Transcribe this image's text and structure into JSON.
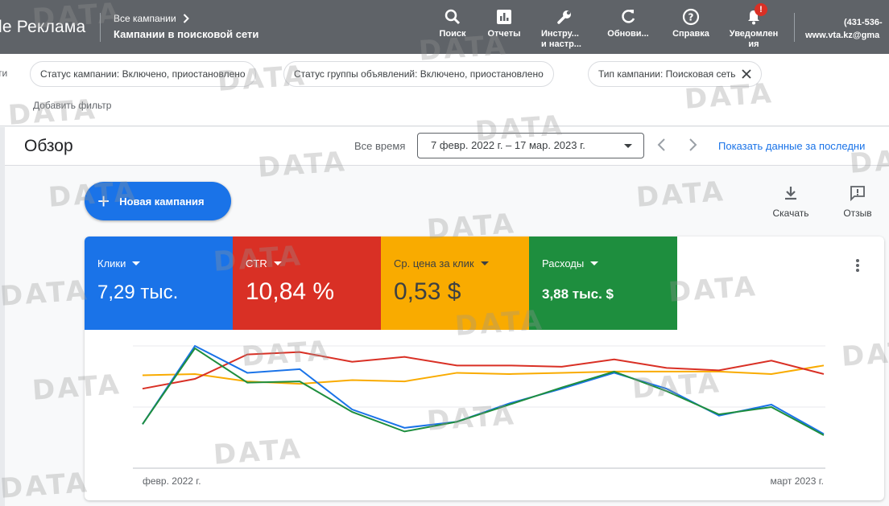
{
  "topbar": {
    "brand": "le Реклама",
    "crumb_parent": "Все кампании",
    "crumb_current": "Кампании в поисковой сети",
    "tools": [
      {
        "label1": "Поиск",
        "label2": "",
        "icon": "search-icon"
      },
      {
        "label1": "Отчеты",
        "label2": "",
        "icon": "reports-icon"
      },
      {
        "label1": "Инстру...",
        "label2": "и настр...",
        "icon": "wrench-icon"
      },
      {
        "label1": "Обнови...",
        "label2": "",
        "icon": "refresh-icon"
      },
      {
        "label1": "Справка",
        "label2": "",
        "icon": "help-icon"
      },
      {
        "label1": "Уведомлен",
        "label2": "ия",
        "icon": "bell-icon"
      }
    ],
    "notification_badge": "!",
    "account_phone": "(431-536-",
    "account_email": "www.vta.kz@gma"
  },
  "filters": {
    "left_cut": "ти",
    "chips": [
      "Статус кампании: Включено, приостановлено",
      "Статус группы объявлений: Включено, приостановлено",
      "Тип кампании: Поисковая сеть"
    ],
    "add_filter": "Добавить фильтр"
  },
  "overview": {
    "title": "Обзор",
    "all_time": "Все время",
    "date_range": "7 февр. 2022 г. – 17 мар. 2023 г.",
    "show_data": "Показать данные за последни",
    "new_campaign": "Новая кампания",
    "download": "Скачать",
    "feedback": "Отзыв"
  },
  "metrics": [
    {
      "label": "Клики",
      "value": "7,29 тыс.",
      "color": "#1a73e8"
    },
    {
      "label": "CTR",
      "value": "10,84 %",
      "color": "#d93025"
    },
    {
      "label": "Ср. цена за клик",
      "value": "0,53 $",
      "color": "#f9ab00"
    },
    {
      "label": "Расходы",
      "value": "3,88 тыс. $",
      "color": "#1e8e3e"
    }
  ],
  "chart_data": {
    "type": "line",
    "x_start_label": "февр. 2022 г.",
    "x_end_label": "март 2023 г.",
    "y_ticks_labeled": false,
    "note_units": "relative (no axis values shown)",
    "series": [
      {
        "name": "Клики",
        "color": "#1a73e8",
        "values": [
          0.36,
          1.0,
          0.78,
          0.81,
          0.48,
          0.33,
          0.38,
          0.53,
          0.65,
          0.78,
          0.65,
          0.43,
          0.52,
          0.28
        ]
      },
      {
        "name": "CTR",
        "color": "#d93025",
        "values": [
          0.65,
          0.73,
          0.93,
          0.95,
          0.87,
          0.91,
          0.84,
          0.84,
          0.83,
          0.89,
          0.82,
          0.8,
          0.88,
          0.77
        ]
      },
      {
        "name": "Ср. цена за клик",
        "color": "#f9ab00",
        "values": [
          0.76,
          0.77,
          0.71,
          0.69,
          0.72,
          0.71,
          0.78,
          0.77,
          0.78,
          0.79,
          0.79,
          0.79,
          0.77,
          0.84
        ]
      },
      {
        "name": "Расходы",
        "color": "#1e8e3e",
        "values": [
          0.36,
          0.98,
          0.7,
          0.71,
          0.46,
          0.3,
          0.38,
          0.52,
          0.66,
          0.79,
          0.63,
          0.44,
          0.5,
          0.27
        ]
      }
    ]
  },
  "watermark": "DATA"
}
